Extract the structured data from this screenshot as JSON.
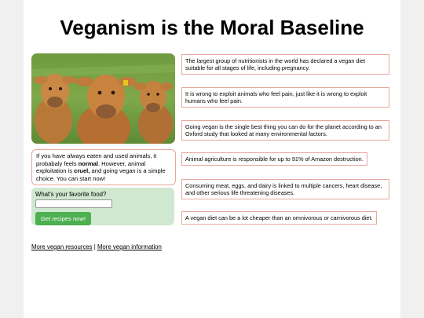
{
  "header": {
    "title": "Veganism is the Moral Baseline"
  },
  "intro": {
    "part1": "If you have always eaten and used animals, it probabaly feels ",
    "normal": "normal",
    "part2": ". However, animal exploitation is ",
    "cruel": "cruel,",
    "part3": " and going vegan is a simple choice. You can start now!"
  },
  "food_form": {
    "label": "What's your favorite food?",
    "input_value": "",
    "button_label": "Get recipes now!"
  },
  "links": {
    "resources": "More vegan resources",
    "separator": " | ",
    "information": "More vegan information"
  },
  "facts": [
    "The largest group of nutritionists in the world has declared a vegan diet suitable for all stages of life, including pregnancy.",
    "It is wrong to exploit animals who feel pain, just like it is wrong to exploit humans who feel pain.",
    "Going vegan is the single best thing you can do for the planet according to an Oxford study that looked at many environmental factors.",
    "Animal agriculture is responsible for up to 91% of Amazon destruction.",
    "Consuming meat, eggs, and dairy is linked to multiple cancers, heart disease, and other serious life threatening diseases.",
    "A vegan diet can be a lot cheaper than an omnivorous or carnivorous diet."
  ],
  "colors": {
    "accent_border": "#e8a89c",
    "form_bg": "#cfe8cf",
    "button_bg": "#4caf50"
  }
}
